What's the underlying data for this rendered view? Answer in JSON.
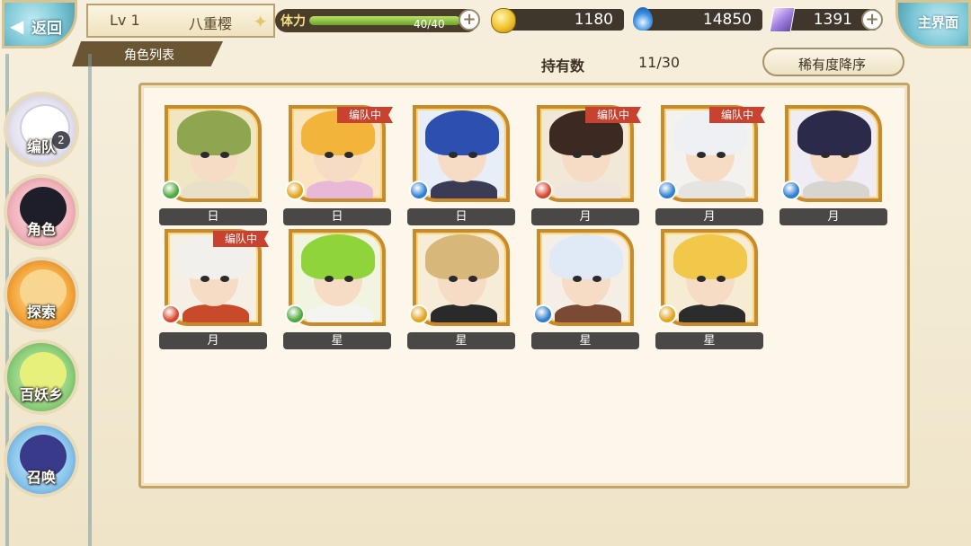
{
  "topbar": {
    "back_label": "返回",
    "level": "Lv 1",
    "player_name": "八重樱",
    "stamina_label": "体力",
    "stamina_value": "40/40",
    "stamina_fraction": 1.0,
    "coins": "1180",
    "soul_fire": "14850",
    "gems": "1391",
    "home_label": "主界面"
  },
  "section": {
    "title": "角色列表",
    "own_label": "持有数",
    "own_value": "11/30",
    "sort_label": "稀有度降序"
  },
  "sidebar": {
    "items": [
      {
        "label": "编队",
        "badge": "2"
      },
      {
        "label": "角色"
      },
      {
        "label": "探索"
      },
      {
        "label": "百妖乡"
      },
      {
        "label": "召唤"
      }
    ]
  },
  "team_tag": "编队中",
  "characters": [
    {
      "attr": "日",
      "element": "wind",
      "in_team": false
    },
    {
      "attr": "日",
      "element": "light",
      "in_team": true
    },
    {
      "attr": "日",
      "element": "water",
      "in_team": false
    },
    {
      "attr": "月",
      "element": "fire",
      "in_team": true
    },
    {
      "attr": "月",
      "element": "water",
      "in_team": true
    },
    {
      "attr": "月",
      "element": "water",
      "in_team": false
    },
    {
      "attr": "月",
      "element": "fire",
      "in_team": true
    },
    {
      "attr": "星",
      "element": "wind",
      "in_team": false
    },
    {
      "attr": "星",
      "element": "light",
      "in_team": false
    },
    {
      "attr": "星",
      "element": "water",
      "in_team": false
    },
    {
      "attr": "星",
      "element": "light",
      "in_team": false
    }
  ],
  "element_colors": {
    "wind": "#4fa83a",
    "light": "#e2a51c",
    "water": "#2f7fd1",
    "fire": "#d8462a"
  },
  "portrait_colors": [
    {
      "hair": "#8fa650",
      "bg": "#f1e6c4",
      "body": "#e8e0c8"
    },
    {
      "hair": "#f2b43a",
      "bg": "#fbe4c2",
      "body": "#e7b9d7"
    },
    {
      "hair": "#2c4fb0",
      "bg": "#e8eef8",
      "body": "#3b3b55"
    },
    {
      "hair": "#3c2a22",
      "bg": "#f2e8d8",
      "body": "#eee6dc"
    },
    {
      "hair": "#eef0f3",
      "bg": "#f4f2ee",
      "body": "#e6e4e0"
    },
    {
      "hair": "#2c2a4a",
      "bg": "#f0ecf4",
      "body": "#d8d4d0"
    },
    {
      "hair": "#f2f0ec",
      "bg": "#f6efe6",
      "body": "#c84a2a"
    },
    {
      "hair": "#8ed43a",
      "bg": "#f0f4e0",
      "body": "#f4f4f0"
    },
    {
      "hair": "#d8b87a",
      "bg": "#f6ecd8",
      "body": "#2a2a2a"
    },
    {
      "hair": "#dfeaf6",
      "bg": "#f4eee6",
      "body": "#7a4a34"
    },
    {
      "hair": "#f2c84a",
      "bg": "#f6ecd4",
      "body": "#2c2c2c"
    }
  ]
}
